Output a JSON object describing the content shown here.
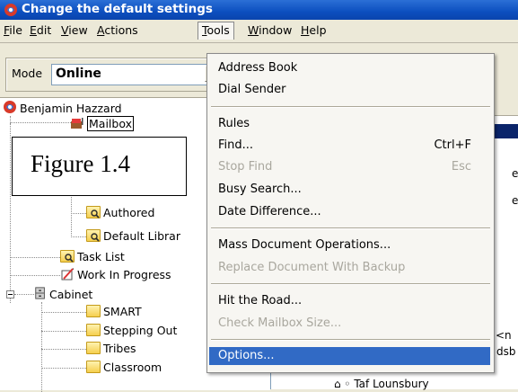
{
  "window": {
    "title": "Change the default settings"
  },
  "menubar": [
    {
      "pre": "",
      "key": "F",
      "post": "ile"
    },
    {
      "pre": "",
      "key": "E",
      "post": "dit"
    },
    {
      "pre": "",
      "key": "V",
      "post": "iew"
    },
    {
      "pre": "",
      "key": "A",
      "post": "ctions"
    },
    {
      "pre": "",
      "key": "T",
      "post": "ools"
    },
    {
      "pre": "",
      "key": "W",
      "post": "indow"
    },
    {
      "pre": "",
      "key": "H",
      "post": "elp"
    }
  ],
  "toolbar": {
    "mode_label": "Mode",
    "mode_value": "Online"
  },
  "tree": {
    "user": "Benjamin Hazzard",
    "mailbox": "Mailbox",
    "authored": "Authored",
    "default_library": "Default Librar",
    "task_list": "Task List",
    "work_in_progress": "Work In Progress",
    "cabinet": "Cabinet",
    "folders": [
      "SMART",
      "Stepping Out",
      "Tribes",
      "Classroom"
    ]
  },
  "right_panel": {
    "fragment_1": "<n",
    "fragment_2": "dsb",
    "fragment_3": "e",
    "fragment_4": "e",
    "fragment_5": "Taf Lounsbury"
  },
  "figure_label": "Figure 1.4",
  "tools_menu": {
    "items": [
      {
        "label": "Address Book",
        "shortcut": "",
        "disabled": false
      },
      {
        "label": "Dial Sender",
        "shortcut": "",
        "disabled": false
      },
      {
        "label": "Rules",
        "shortcut": "",
        "disabled": false
      },
      {
        "label": "Find...",
        "shortcut": "Ctrl+F",
        "disabled": false
      },
      {
        "label": "Stop Find",
        "shortcut": "Esc",
        "disabled": true
      },
      {
        "label": "Busy Search...",
        "shortcut": "",
        "disabled": false
      },
      {
        "label": "Date Difference...",
        "shortcut": "",
        "disabled": false
      },
      {
        "label": "Mass Document Operations...",
        "shortcut": "",
        "disabled": false
      },
      {
        "label": "Replace Document With Backup",
        "shortcut": "",
        "disabled": true
      },
      {
        "label": "Hit the Road...",
        "shortcut": "",
        "disabled": false
      },
      {
        "label": "Check Mailbox Size...",
        "shortcut": "",
        "disabled": true
      },
      {
        "label": "Options...",
        "shortcut": "",
        "disabled": false,
        "highlighted": true
      }
    ]
  },
  "colors": {
    "titlebar": "#0c4fbf",
    "highlight": "#316ac5",
    "disabled_text": "#a9a79e"
  }
}
